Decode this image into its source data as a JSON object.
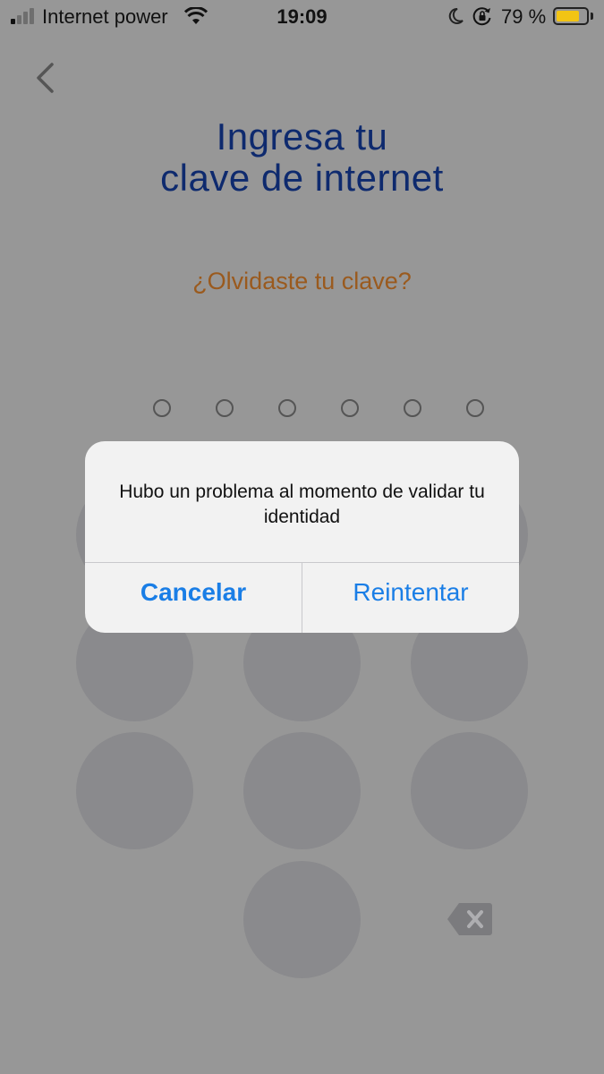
{
  "status_bar": {
    "carrier": "Internet power",
    "time": "19:09",
    "battery_percent": "79 %",
    "battery_level": 0.79,
    "signal_bars": 4,
    "signal_active_bars": 1,
    "icons": [
      "signal-icon",
      "wifi-icon",
      "moon-icon",
      "rotation-lock-icon",
      "battery-icon"
    ]
  },
  "header": {
    "back_icon": "chevron-left-icon",
    "title_line1": "Ingresa tu",
    "title_line2": "clave de internet",
    "forgot_link": "¿Olvidaste tu clave?"
  },
  "pin": {
    "digits": 6,
    "filled": 0
  },
  "keypad": {
    "delete_icon": "backspace-icon"
  },
  "alert": {
    "message": "Hubo un problema al momento de validar tu identidad",
    "cancel_label": "Cancelar",
    "retry_label": "Reintentar"
  },
  "colors": {
    "title": "#0e2a6e",
    "link": "#9a5a1e",
    "alert_button": "#1a7ee6",
    "battery": "#f2c414",
    "overlay_background": "#979797"
  }
}
